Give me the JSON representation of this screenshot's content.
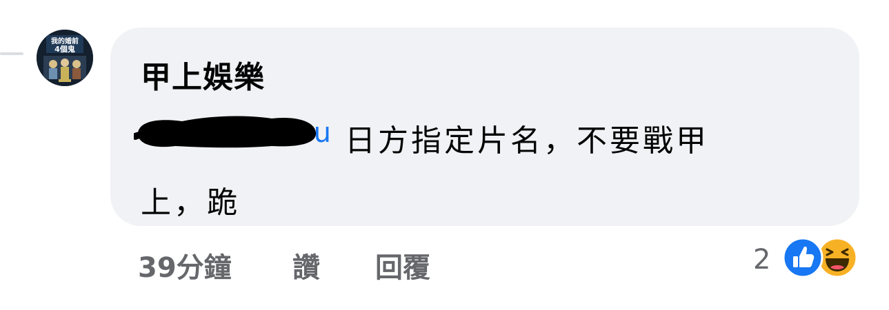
{
  "comment": {
    "author": "甲上娛樂",
    "mention_visible_tail": "u",
    "text_line1": "日方指定片名，不要戰甲",
    "text_line2": "上，跪"
  },
  "actions": {
    "timestamp": "39分鐘",
    "like_label": "讚",
    "reply_label": "回覆"
  },
  "reactions": {
    "count": "2",
    "types": [
      "like",
      "haha"
    ]
  },
  "avatar": {
    "logo_text": "我的婚前4個鬼",
    "colors": {
      "background": "#14202e",
      "title": "#ffffff",
      "accent": "#c9b35a"
    }
  },
  "colors": {
    "bubble": "#f0f2f5",
    "text": "#050505",
    "secondary": "#65676b",
    "link": "#1877f2",
    "like_blue": "#1877f2",
    "haha_yellow": "#f7b125"
  }
}
